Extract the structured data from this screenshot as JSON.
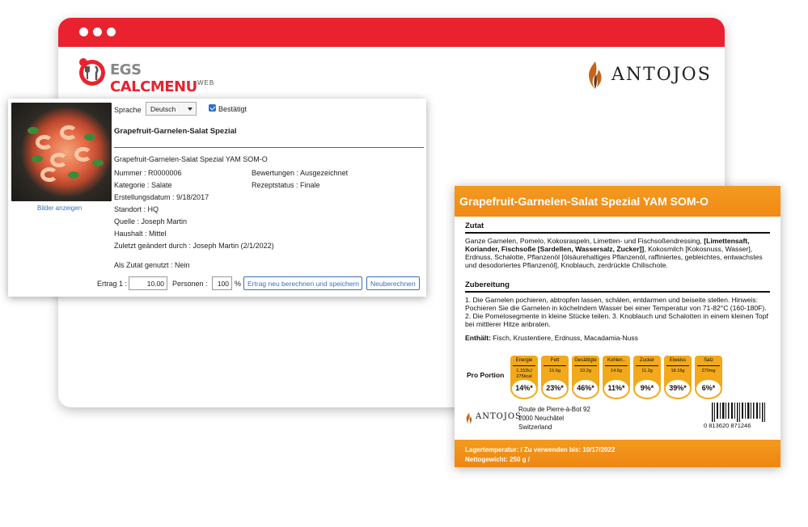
{
  "header": {
    "egs_brand_part1": "EGS",
    "egs_brand_part2": "CALCMENU",
    "egs_brand_sub": "WEB",
    "antojos_brand": "ANTOJOS"
  },
  "recipe_panel": {
    "show_images": "Bilder anzeigen",
    "language_label": "Sprache",
    "language_value": "Deutsch",
    "confirmed_label": "Bestätigt",
    "title": "Grapefruit-Garnelen-Salat Spezial",
    "subtitle": "Grapefruit-Garnelen-Salat Spezial YAM SOM-O",
    "number": "Nummer : R0000006",
    "category": "Kategorie : Salate",
    "created": "Erstellungsdatum : 9/18/2017",
    "location": "Standort : HQ",
    "source": "Quelle :  Joseph Martin",
    "household": "Haushalt : Mittel",
    "modified": "Zuletzt geändert durch : Joseph Martin (2/1/2022)",
    "rating": "Bewertungen : Ausgezeichnet",
    "status": "Rezeptstatus : Finale",
    "used_as_ingredient": "Als Zutat genutzt : Nein",
    "yield_label": "Ertrag 1 :",
    "yield_value": "10.00",
    "persons_label": "Personen :",
    "persons_value": "100",
    "percent_sign": "%",
    "recalc_save_button": "Ertrag neu berechnen und speichern",
    "recalc_button": "Neuberechnen"
  },
  "label_card": {
    "title": "Grapefruit-Garnelen-Salat Spezial YAM SOM-O",
    "ingredients_title": "Zutat",
    "ingredients_plain1": "Ganze Garnelen, Pomelo, Kokosraspeln, Limetten- und Fischsoßendressing,",
    "ingredients_bold": "[Limettensaft, Koriander, Fischsoße [Sardellen, Wassersalz, Zucker]]",
    "ingredients_plain2": ", Kokosmilch [Kokosnuss, Wasser], Erdnuss, Schalotte, Pflanzenöl [ölsäurehaltiges Pflanzenöl, raffiniertes, gebleichtes, entwachstes und desodoriertes Pflanzenöl], Knoblauch, zerdrückte Chilischote.",
    "prep_title": "Zubereitung",
    "prep_text": "1. Die Garnelen pochieren, abtropfen lassen, schälen, entdarmen und beiseite stellen. Hinweis: Pochieren Sie die Garnelen in köchelndem Wasser bei einer Temperatur von 71-82°C (160-180F). 2. Die Pomelosegmente in kleine Stücke teilen. 3. Knoblauch und Schalotten in einem kleinen Topf bei mittlerer Hitze anbraten.",
    "contains_label": "Enthält:",
    "contains_text": " Fisch, Krustentiere, Erdnuss, Macadamia-Nuss",
    "per_portion": "Pro Portion",
    "nutrients": [
      {
        "name": "Energie",
        "value": "1,152kJ\n275kcal",
        "percent": "14%*"
      },
      {
        "name": "Fett",
        "value": "15.6g",
        "percent": "23%*"
      },
      {
        "name": "Gesättigte",
        "value": "10.2g",
        "percent": "46%*"
      },
      {
        "name": "Kohlen..",
        "value": "14.6g",
        "percent": "11%*"
      },
      {
        "name": "Zucker",
        "value": "11.2g",
        "percent": "9%*"
      },
      {
        "name": "Eiweiss",
        "value": "18.16g",
        "percent": "39%*"
      },
      {
        "name": "Salz",
        "value": "270mg",
        "percent": "6%*"
      }
    ],
    "brand": "ANTOJOS",
    "address_line1": "Route de Pierre-à-Bot 92",
    "address_line2": "2000 Neuchâtel",
    "address_line3": "Switzerland",
    "barcode_number": "0   813620   871246",
    "storage": "Lagertemperatur:   / Zu verwenden bis: 10/17/2022",
    "net_weight": "Nettogewicht: 250 g /"
  },
  "colors": {
    "brand_red": "#e8232f",
    "label_orange": "#f08a16",
    "nutrient_yellow": "#f2a91b",
    "link_blue": "#3a6fbf"
  }
}
